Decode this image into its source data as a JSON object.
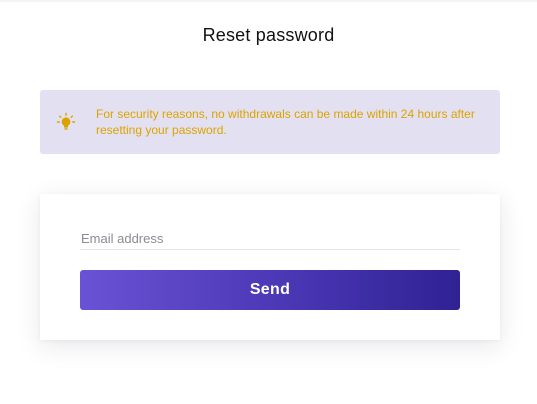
{
  "header": {
    "title": "Reset password"
  },
  "notice": {
    "icon": "lightbulb-icon",
    "text": "For security reasons, no withdrawals can be made within 24 hours after resetting your password.",
    "background_color": "#e3e1f1",
    "text_color": "#dca300"
  },
  "form": {
    "email_placeholder": "Email address",
    "email_value": "",
    "send_label": "Send",
    "button_gradient": [
      "#6a52d4",
      "#2f2294"
    ]
  }
}
